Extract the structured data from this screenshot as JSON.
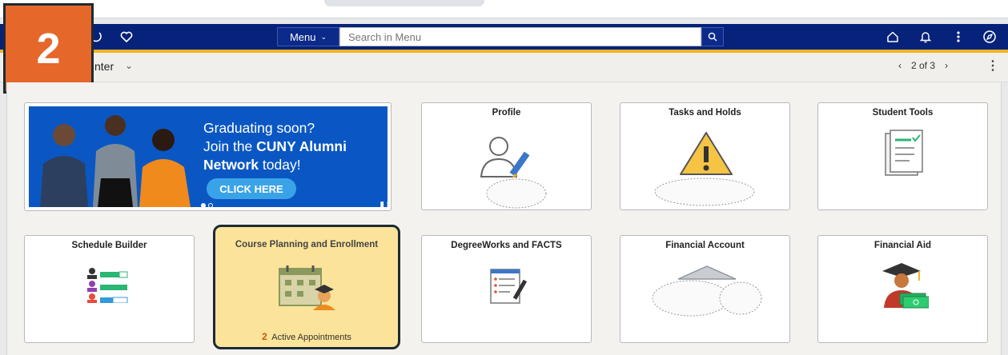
{
  "nav": {
    "menu_label": "Menu",
    "search_placeholder": "Search in Menu"
  },
  "subbar": {
    "title": "nter",
    "pager": "2 of 3"
  },
  "step_badge": "2",
  "banner": {
    "line1": "Graduating soon?",
    "line2a": "Join the ",
    "line2b": "CUNY Alumni",
    "line3a": "Network",
    "line3b": " today!",
    "button": "CLICK HERE"
  },
  "tiles": [
    {
      "title": "Profile",
      "icon": "profile-edit-icon"
    },
    {
      "title": "Tasks and Holds",
      "icon": "warning-icon"
    },
    {
      "title": "Student Tools",
      "icon": "checklist-document-icon"
    },
    {
      "title": "Schedule Builder",
      "icon": "schedule-builder-icon"
    },
    {
      "title": "Course Planning and Enrollment",
      "icon": "calendar-student-icon",
      "count": "2",
      "count_label": "Active Appointments"
    },
    {
      "title": "DegreeWorks and FACTS",
      "icon": "document-pen-icon"
    },
    {
      "title": "Financial Account",
      "icon": "bank-icon"
    },
    {
      "title": "Financial Aid",
      "icon": "graduate-money-icon"
    }
  ],
  "colors": {
    "navbar": "#06227a",
    "accent": "#f0b323",
    "badge": "#e5672a",
    "banner": "#0a57c3",
    "highlight_tile": "#fbe39a"
  }
}
